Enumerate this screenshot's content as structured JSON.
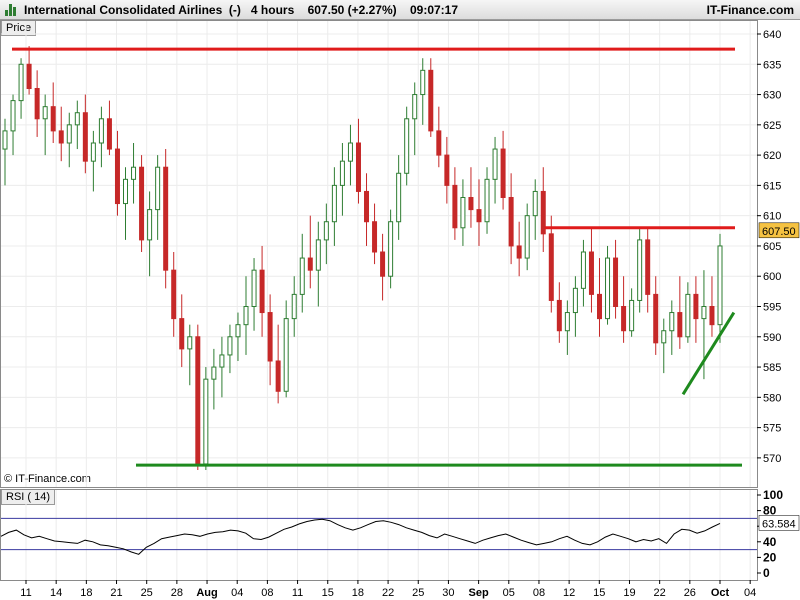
{
  "header": {
    "title": "International Consolidated Airlines  (-)   4 hours    607.50 (+2.27%)    09:07:17",
    "brand": "IT-Finance.com"
  },
  "price_panel": {
    "label": "Price",
    "copyright": "© IT-Finance.com"
  },
  "rsi_panel": {
    "label": "RSI ( 14)"
  },
  "colors": {
    "up": "#2e7d32",
    "down": "#c62828",
    "resistance": "#e01b1b",
    "support": "#1e8a1e",
    "rsi_line": "#000000",
    "rsi_levels": "#3a3aa0",
    "price_tag_bg": "#f5c242"
  },
  "chart_data": [
    {
      "type": "candlestick",
      "title": "International Consolidated Airlines",
      "ylim": [
        566,
        641
      ],
      "y_ticks": [
        570,
        575,
        580,
        585,
        590,
        595,
        600,
        605,
        610,
        615,
        620,
        625,
        630,
        635,
        640
      ],
      "x_ticks": [
        "11",
        "14",
        "18",
        "21",
        "25",
        "28",
        "Aug",
        "04",
        "08",
        "11",
        "15",
        "18",
        "22",
        "25",
        "30",
        "Sep",
        "05",
        "08",
        "12",
        "15",
        "19",
        "22",
        "26",
        "Oct",
        "04"
      ],
      "last_price": "607.50",
      "grid": true,
      "candles": [
        [
          621,
          626,
          615,
          624
        ],
        [
          624,
          630,
          620,
          629
        ],
        [
          629,
          636,
          626,
          635
        ],
        [
          635,
          638,
          630,
          631
        ],
        [
          631,
          634,
          623,
          626
        ],
        [
          626,
          630,
          620,
          628
        ],
        [
          628,
          632,
          622,
          624
        ],
        [
          624,
          628,
          619,
          622
        ],
        [
          622,
          627,
          618,
          625
        ],
        [
          625,
          629,
          621,
          627
        ],
        [
          627,
          630,
          617,
          619
        ],
        [
          619,
          624,
          614,
          622
        ],
        [
          622,
          628,
          618,
          626
        ],
        [
          626,
          629,
          620,
          621
        ],
        [
          621,
          624,
          610,
          612
        ],
        [
          612,
          618,
          606,
          616
        ],
        [
          616,
          622,
          612,
          618
        ],
        [
          618,
          620,
          604,
          606
        ],
        [
          606,
          614,
          600,
          611
        ],
        [
          611,
          620,
          606,
          618
        ],
        [
          618,
          621,
          598,
          601
        ],
        [
          601,
          604,
          590,
          593
        ],
        [
          593,
          597,
          585,
          588
        ],
        [
          588,
          592,
          582,
          590
        ],
        [
          590,
          592,
          568,
          569
        ],
        [
          569,
          585,
          568,
          583
        ],
        [
          583,
          588,
          578,
          585
        ],
        [
          585,
          590,
          580,
          587
        ],
        [
          587,
          592,
          584,
          590
        ],
        [
          590,
          594,
          586,
          592
        ],
        [
          592,
          600,
          587,
          595
        ],
        [
          595,
          603,
          591,
          601
        ],
        [
          601,
          605,
          590,
          594
        ],
        [
          594,
          597,
          582,
          586
        ],
        [
          586,
          592,
          579,
          581
        ],
        [
          581,
          596,
          580,
          593
        ],
        [
          593,
          600,
          590,
          597
        ],
        [
          597,
          607,
          594,
          603
        ],
        [
          603,
          610,
          598,
          601
        ],
        [
          601,
          609,
          595,
          606
        ],
        [
          606,
          612,
          602,
          609
        ],
        [
          609,
          618,
          605,
          615
        ],
        [
          615,
          622,
          610,
          619
        ],
        [
          619,
          625,
          615,
          622
        ],
        [
          622,
          626,
          612,
          614
        ],
        [
          614,
          617,
          605,
          609
        ],
        [
          609,
          612,
          602,
          604
        ],
        [
          604,
          607,
          596,
          600
        ],
        [
          600,
          611,
          598,
          609
        ],
        [
          609,
          620,
          606,
          617
        ],
        [
          617,
          628,
          615,
          626
        ],
        [
          626,
          632,
          620,
          630
        ],
        [
          630,
          636,
          625,
          634
        ],
        [
          634,
          636,
          623,
          624
        ],
        [
          624,
          628,
          618,
          620
        ],
        [
          620,
          623,
          612,
          615
        ],
        [
          615,
          618,
          606,
          608
        ],
        [
          608,
          616,
          605,
          613
        ],
        [
          613,
          618,
          608,
          611
        ],
        [
          611,
          616,
          605,
          609
        ],
        [
          609,
          618,
          607,
          616
        ],
        [
          616,
          623,
          612,
          621
        ],
        [
          621,
          624,
          611,
          613
        ],
        [
          613,
          617,
          602,
          605
        ],
        [
          605,
          609,
          600,
          603
        ],
        [
          603,
          612,
          601,
          610
        ],
        [
          610,
          616,
          606,
          614
        ],
        [
          614,
          618,
          604,
          607
        ],
        [
          607,
          610,
          594,
          596
        ],
        [
          596,
          599,
          589,
          591
        ],
        [
          591,
          596,
          587,
          594
        ],
        [
          594,
          600,
          590,
          598
        ],
        [
          598,
          606,
          595,
          604
        ],
        [
          604,
          608,
          594,
          597
        ],
        [
          597,
          603,
          590,
          593
        ],
        [
          593,
          605,
          592,
          603
        ],
        [
          603,
          606,
          593,
          595
        ],
        [
          595,
          600,
          589,
          591
        ],
        [
          591,
          598,
          590,
          596
        ],
        [
          596,
          608,
          594,
          606
        ],
        [
          606,
          608,
          594,
          597
        ],
        [
          597,
          600,
          587,
          589
        ],
        [
          589,
          593,
          584,
          591
        ],
        [
          591,
          596,
          587,
          594
        ],
        [
          594,
          600,
          588,
          590
        ],
        [
          590,
          599,
          589,
          597
        ],
        [
          597,
          600,
          589,
          593
        ],
        [
          593,
          601,
          583,
          595
        ],
        [
          595,
          600,
          590,
          592
        ],
        [
          592,
          607,
          589,
          605
        ]
      ],
      "levels": [
        {
          "kind": "resistance",
          "value": 637.5
        },
        {
          "kind": "resistance",
          "value": 608.0
        },
        {
          "kind": "support",
          "value": 568.8
        }
      ],
      "trendline": {
        "from": [
          0.79,
          580.5
        ],
        "to": [
          0.84,
          594.0
        ]
      }
    },
    {
      "type": "line",
      "title": "RSI ( 14)",
      "ylim": [
        0,
        100
      ],
      "y_ticks": [
        0,
        20,
        40,
        60,
        80,
        100
      ],
      "levels": [
        30,
        70
      ],
      "last_value": "63.584",
      "values": [
        47,
        52,
        55,
        49,
        45,
        47,
        44,
        41,
        40,
        39,
        38,
        42,
        40,
        36,
        35,
        33,
        31,
        27,
        24,
        33,
        38,
        44,
        46,
        48,
        50,
        49,
        47,
        50,
        52,
        53,
        55,
        54,
        51,
        44,
        43,
        46,
        51,
        56,
        59,
        63,
        66,
        68,
        69,
        67,
        62,
        58,
        55,
        58,
        62,
        66,
        67,
        65,
        62,
        58,
        55,
        52,
        48,
        45,
        50,
        47,
        44,
        41,
        38,
        42,
        45,
        48,
        50,
        46,
        42,
        39,
        36,
        38,
        40,
        44,
        47,
        42,
        38,
        36,
        40,
        46,
        50,
        47,
        44,
        40,
        43,
        41,
        44,
        38,
        50,
        56,
        55,
        51,
        54,
        59,
        63.584
      ]
    }
  ]
}
